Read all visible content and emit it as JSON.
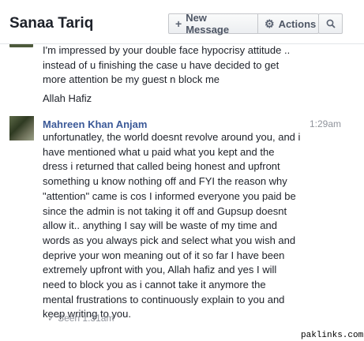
{
  "header": {
    "title": "Sanaa Tariq",
    "new_message_label": "New Message",
    "actions_label": "Actions"
  },
  "messages": [
    {
      "text_lines": "I'm impressed by your double face hypocrisy attitude ..\ninstead of u finishing the case u have decided to get\nmore attention be my guest n block me",
      "signoff": "Allah Hafiz"
    },
    {
      "sender": "Mahreen Khan Anjam",
      "time": "1:29am",
      "text": "unfortunatley, the world doesnt revolve around you, and i\nhave  mentioned what u paid what you kept and the\ndress i returned that called being honest and upfront\nsomething u know  nothing off and FYI the reason why\n\"attention\" came is cos I informed everyone you paid be\nsince the admin is not taking it off and Gupsup doesnt\nallow it..  anything I say will be waste of my time and\nwords as you always pick and select what you wish and\ndeprive your won meaning out of it so far I have been\nextremely upfront with you, Allah hafiz and yes I will\nneed to block you as i cannot take it anymore the\nmental frustrations to continuously explain to you and\nkeep writing to you."
    }
  ],
  "seen": "Seen 1:31am",
  "watermark": "paklinks.com",
  "icons": {
    "new_message": "plus-icon",
    "actions": "gear-icon",
    "search": "search-icon",
    "seen": "checkmark-icon"
  }
}
